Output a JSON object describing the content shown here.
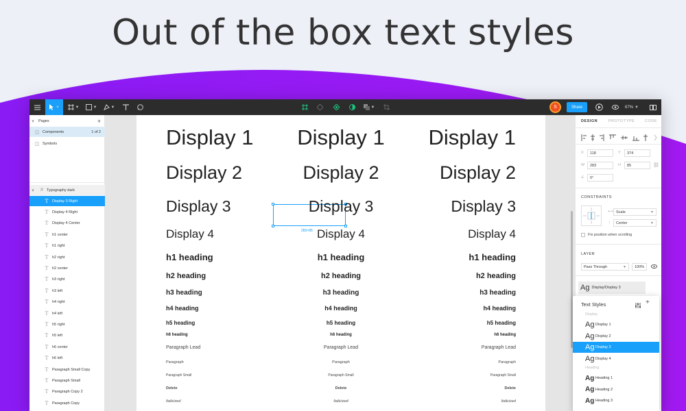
{
  "headline": "Out of the box text styles",
  "colors": {
    "accent": "#18a0fb",
    "purple": "#9b14f6",
    "toolbar": "#2c2c2c"
  },
  "toolbar": {
    "share_label": "Share",
    "user_initial": "S",
    "zoom": "67%"
  },
  "pages_panel": {
    "title": "Pages",
    "add": "+",
    "pages": [
      {
        "name": "Components",
        "count": "1 of 2"
      },
      {
        "name": "Symbols"
      }
    ],
    "frame_name": "Typography dark",
    "layers": [
      "Display 3 Right",
      "Display 4 Right",
      "Display 4 Center",
      "h1 center",
      "h1 right",
      "h2 right",
      "h2 center",
      "h3 right",
      "h3 left",
      "h4 right",
      "h4 left",
      "h5 right",
      "h5 left",
      "h6 center",
      "h6 left",
      "Paragraph Small Copy",
      "Paragraph Small",
      "Paragraph Copy 2",
      "Paragraph Copy"
    ]
  },
  "canvas": {
    "styles": [
      "Display 1",
      "Display 2",
      "Display 3",
      "Display 4",
      "h1 heading",
      "h2 heading",
      "h3 heading",
      "h4 heading",
      "h5 heading",
      "h6 heading",
      "Paragraph Lead",
      "Paragraph",
      "Paragraph Small",
      "Delete",
      "Italicized"
    ],
    "selection_size": "283×85"
  },
  "design_panel": {
    "tabs": [
      "DESIGN",
      "PROTOTYPE",
      "CODE"
    ],
    "x_label": "X",
    "x": "118",
    "y_label": "Y",
    "y": "374",
    "w_label": "W",
    "w": "283",
    "h_label": "H",
    "h": "85",
    "rotation_label": "∠",
    "rotation": "0°",
    "constraints_title": "CONSTRAINTS",
    "constraint_h": "Scale",
    "constraint_v": "Center",
    "fix_position": "Fix position when scrolling",
    "layer_title": "LAYER",
    "blend_mode": "Pass Through",
    "opacity": "100%",
    "text_style_chip": "Display/Display 3"
  },
  "text_styles_popup": {
    "title": "Text Styles",
    "groups": [
      {
        "name": "Display",
        "items": [
          "Display 1",
          "Display 2",
          "Display 3",
          "Display 4"
        ]
      },
      {
        "name": "Heading",
        "items": [
          "Heading 1",
          "Heading 2",
          "Heading 3"
        ]
      }
    ],
    "ag": "Ag",
    "selected": "Display 3"
  }
}
